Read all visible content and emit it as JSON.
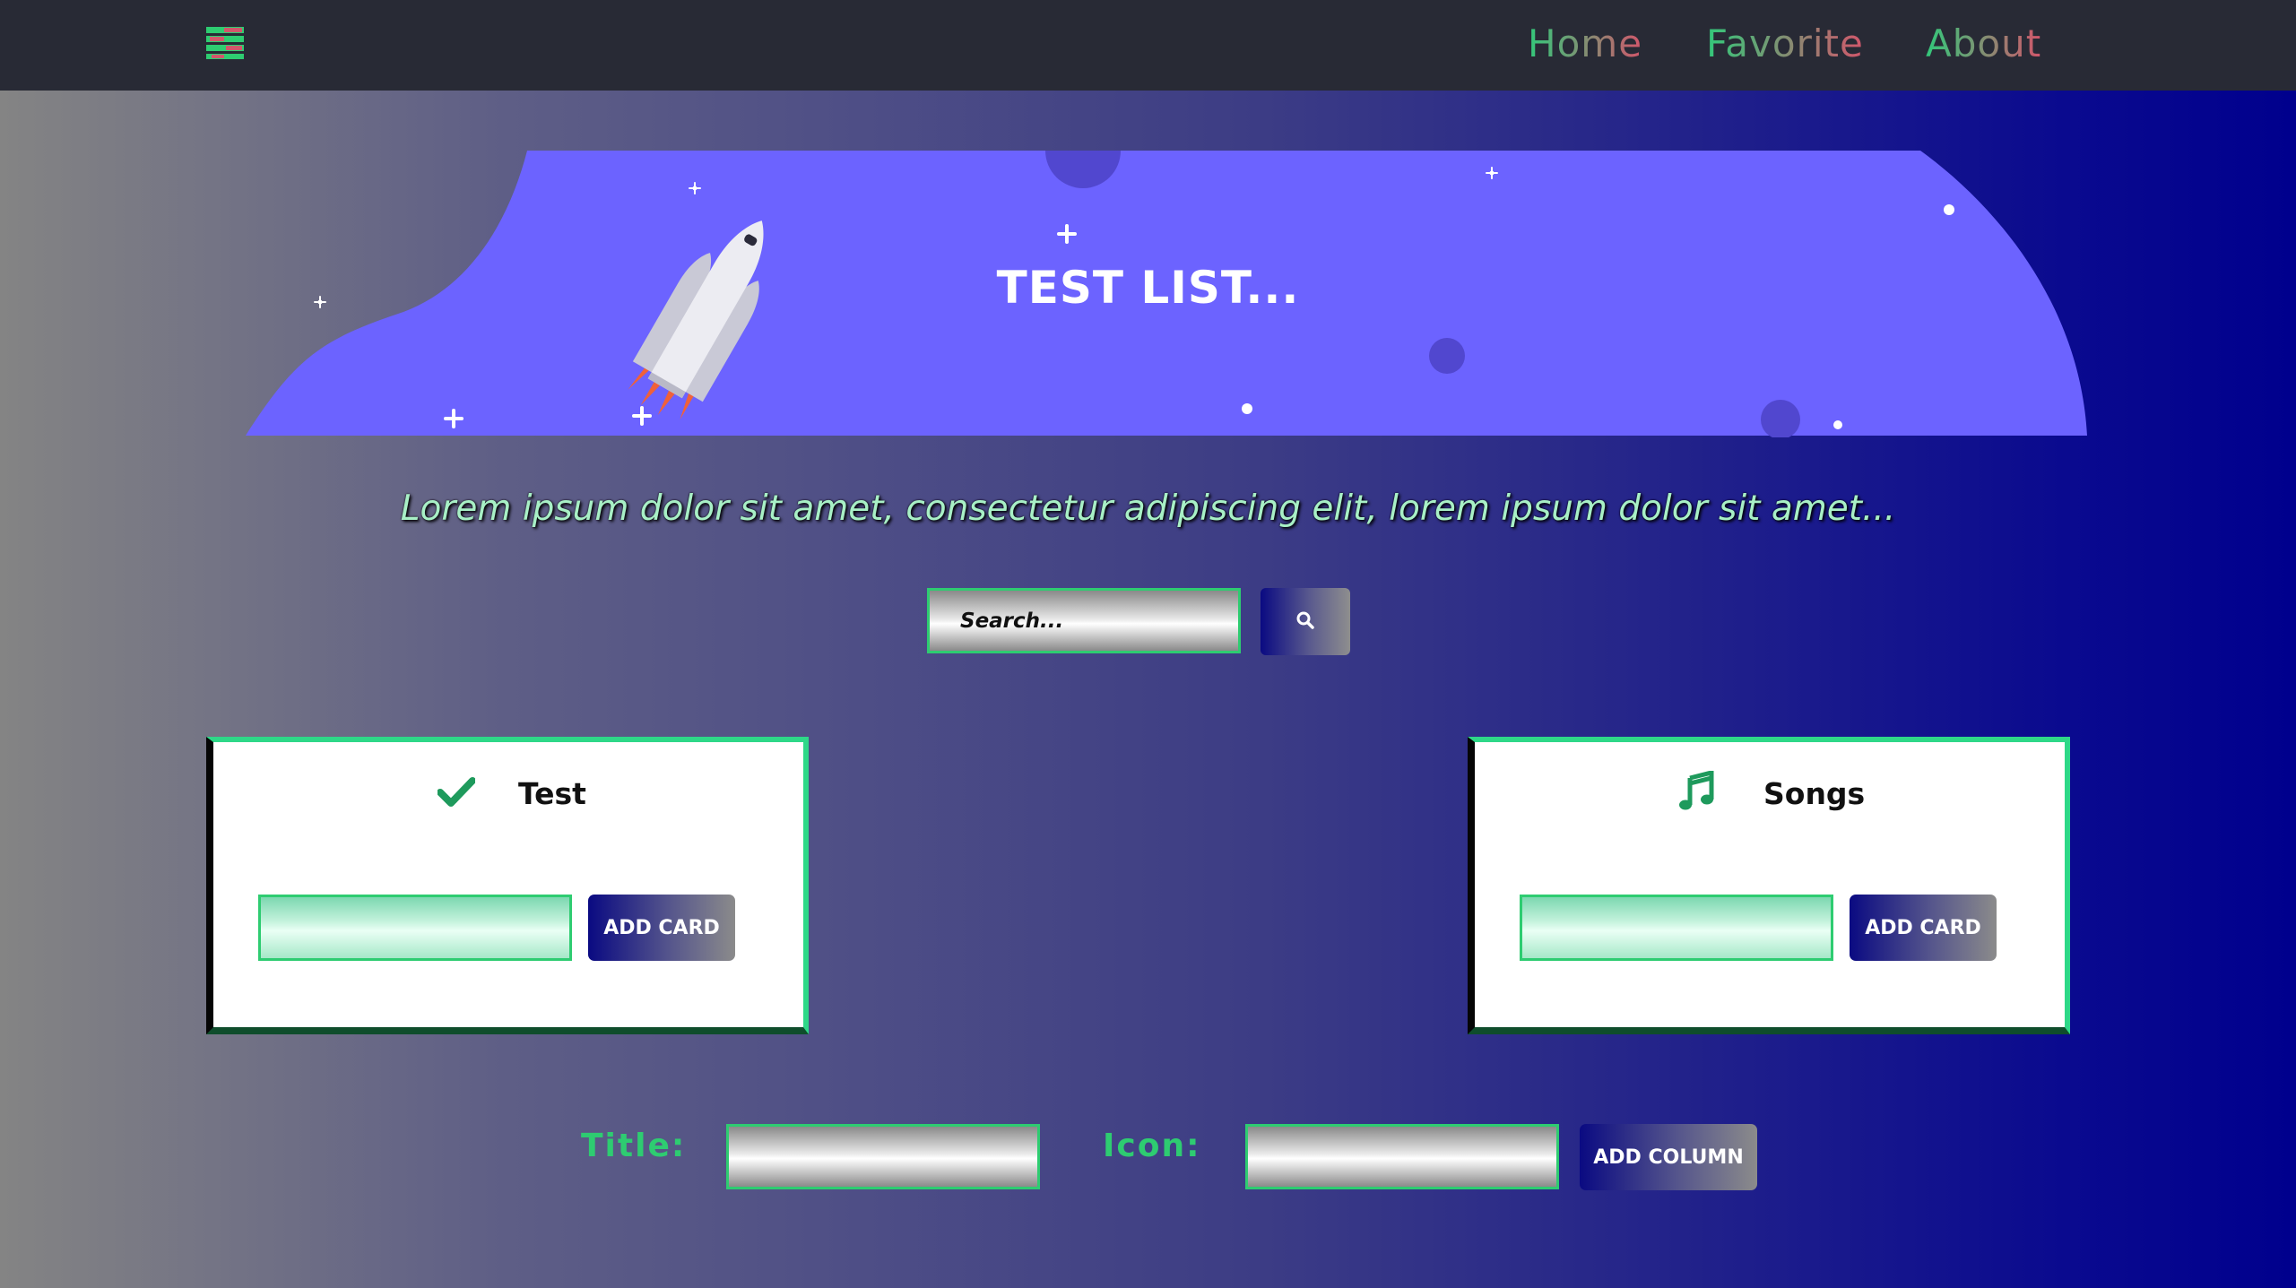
{
  "navbar": {
    "menu_icon": "menu-icon",
    "links": [
      "Home",
      "Favorite",
      "About"
    ]
  },
  "hero": {
    "title": "TEST LIST...",
    "illustration": "rocket-icon"
  },
  "tagline": "Lorem ipsum dolor sit amet, consectetur adipiscing elit, lorem ipsum dolor sit amet...",
  "search": {
    "placeholder": "Search...",
    "button_icon": "search-icon"
  },
  "columns": [
    {
      "title": "Test",
      "icon": "check-icon",
      "input_value": "",
      "button_label": "ADD CARD"
    },
    {
      "title": "Songs",
      "icon": "music-note-icon",
      "input_value": "",
      "button_label": "ADD CARD"
    }
  ],
  "add_column_form": {
    "title_label": "Title:",
    "icon_label": "Icon:",
    "title_value": "",
    "icon_value": "",
    "button_label": "ADD COLUMN"
  },
  "colors": {
    "navbar_bg": "#282a35",
    "accent_green": "#2ecc71",
    "hero_purple": "#6c63ff",
    "navy": "#0a0a82"
  }
}
